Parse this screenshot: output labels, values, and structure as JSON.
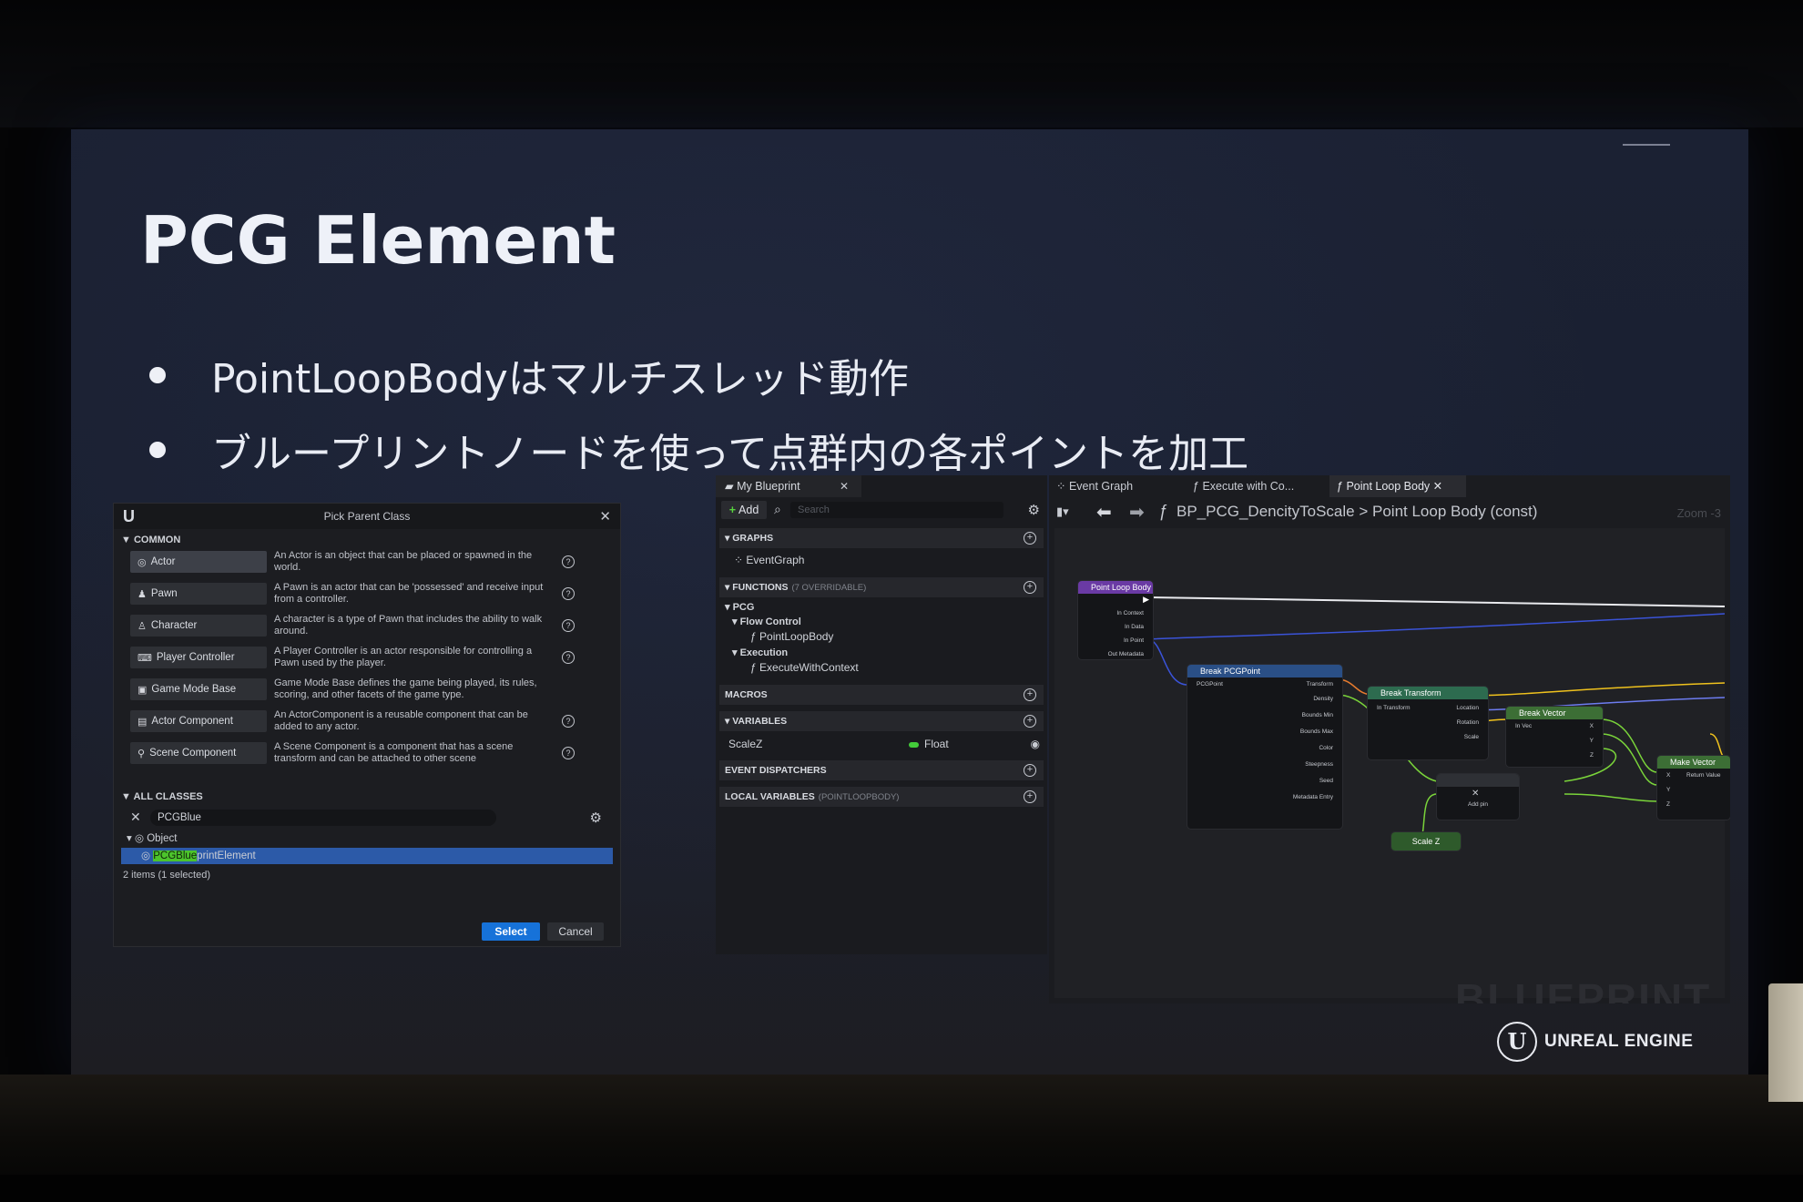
{
  "slide": {
    "title": "PCG Element",
    "bullets": [
      "PointLoopBodyはマルチスレッド動作",
      "ブループリントノードを使って点群内の各ポイントを加工"
    ]
  },
  "pick_parent_class": {
    "title": "Pick Parent Class",
    "logo": "U",
    "common_label": "COMMON",
    "classes": [
      {
        "name": "Actor",
        "icon": "actor-icon",
        "desc": "An Actor is an object that can be placed or spawned in the world."
      },
      {
        "name": "Pawn",
        "icon": "pawn-icon",
        "desc": "A Pawn is an actor that can be 'possessed' and receive input from a controller."
      },
      {
        "name": "Character",
        "icon": "character-icon",
        "desc": "A character is a type of Pawn that includes the ability to walk around."
      },
      {
        "name": "Player Controller",
        "icon": "gamepad-icon",
        "desc": "A Player Controller is an actor responsible for controlling a Pawn used by the player."
      },
      {
        "name": "Game Mode Base",
        "icon": "gamemode-icon",
        "desc": "Game Mode Base defines the game being played, its rules, scoring, and other facets of the game type."
      },
      {
        "name": "Actor Component",
        "icon": "component-icon",
        "desc": "An ActorComponent is a reusable component that can be added to any actor."
      },
      {
        "name": "Scene Component",
        "icon": "scene-component-icon",
        "desc": "A Scene Component is a component that has a scene transform and can be attached to other scene"
      }
    ],
    "all_classes_label": "ALL CLASSES",
    "search_value": "PCGBlue",
    "tree": {
      "root": "Object",
      "match_prefix": "PCGBlue",
      "match_suffix": "printElement"
    },
    "items_count": "2 items (1 selected)",
    "select_label": "Select",
    "cancel_label": "Cancel"
  },
  "my_blueprint": {
    "tab_label": "My Blueprint",
    "add_label": "Add",
    "search_placeholder": "Search",
    "graphs_label": "GRAPHS",
    "event_graph": "EventGraph",
    "functions_label": "FUNCTIONS",
    "functions_sub": "(7 OVERRIDABLE)",
    "pcg_label": "PCG",
    "flow_control_label": "Flow Control",
    "point_loop_body": "PointLoopBody",
    "execution_label": "Execution",
    "execute_with_context": "ExecuteWithContext",
    "macros_label": "MACROS",
    "variables_label": "VARIABLES",
    "var_name": "ScaleZ",
    "var_type": "Float",
    "event_dispatchers_label": "EVENT DISPATCHERS",
    "local_variables_label": "LOCAL VARIABLES",
    "local_variables_sub": "(POINTLOOPBODY)"
  },
  "graph_editor": {
    "tabs": [
      "Event Graph",
      "Execute with Co...",
      "Point Loop Body"
    ],
    "breadcrumb_asset": "BP_PCG_DencityToScale",
    "breadcrumb_sep": ">",
    "breadcrumb_function": "Point Loop Body (const)",
    "zoom": "Zoom -3",
    "watermark": "BLUEPRINT",
    "nodes": {
      "entry": {
        "title": "Point Loop Body",
        "pins": [
          "In Context",
          "In Data",
          "In Point",
          "Out Metadata"
        ]
      },
      "break_pcg_point": {
        "title": "Break PCGPoint",
        "in": "PCGPoint",
        "out": [
          "Transform",
          "Density",
          "Bounds Min",
          "Bounds Max",
          "Color",
          "Steepness",
          "Seed",
          "Metadata Entry"
        ]
      },
      "break_transform": {
        "title": "Break Transform",
        "in": "In Transform",
        "out": [
          "Location",
          "Rotation",
          "Scale"
        ]
      },
      "break_vector": {
        "title": "Break Vector",
        "in": "In Vec",
        "out": [
          "X",
          "Y",
          "Z"
        ]
      },
      "multiply": {
        "title": "",
        "add_pin": "Add pin"
      },
      "make_vector": {
        "title": "Make Vector",
        "in": [
          "X",
          "Y",
          "Z"
        ],
        "out": "Return Value"
      },
      "scale_z": {
        "title": "Scale Z"
      }
    }
  },
  "branding": {
    "engine": "UNREAL ENGINE",
    "logo_letter": "U"
  }
}
